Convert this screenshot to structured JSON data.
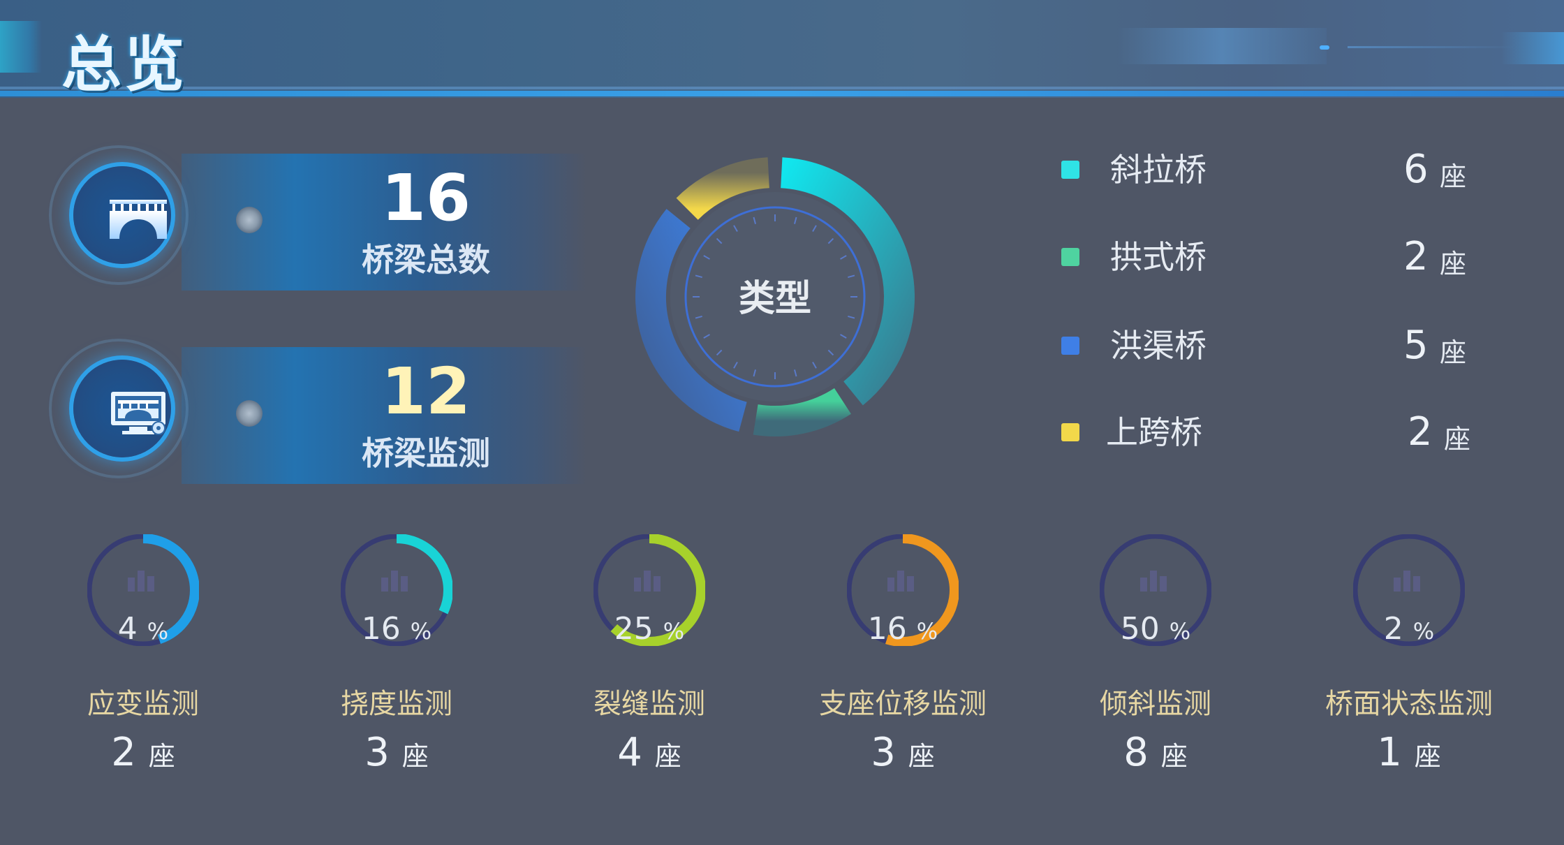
{
  "header": {
    "title": "总览"
  },
  "stats": [
    {
      "value": "16",
      "label": "桥梁总数",
      "icon": "bridge-icon"
    },
    {
      "value": "12",
      "label": "桥梁监测",
      "icon": "monitor-icon"
    }
  ],
  "chart_data": {
    "type": "pie",
    "title": "类型",
    "unit": "座",
    "categories": [
      "斜拉桥",
      "拱式桥",
      "洪渠桥",
      "上跨桥"
    ],
    "values": [
      6,
      2,
      5,
      2
    ],
    "colors": [
      "#2fe3e6",
      "#4fd3a0",
      "#3f7fe6",
      "#f2d84a"
    ]
  },
  "legend": {
    "unit": "座",
    "items": [
      {
        "name": "斜拉桥",
        "count": "6",
        "color": "#2fe3e6"
      },
      {
        "name": "拱式桥",
        "count": "2",
        "color": "#4fd3a0"
      },
      {
        "name": "洪渠桥",
        "count": "5",
        "color": "#3f7fe6"
      },
      {
        "name": "上跨桥",
        "count": "2",
        "color": "#f2d84a"
      }
    ]
  },
  "gauges": {
    "unit": "座",
    "pct_unit": "%",
    "items": [
      {
        "percent": 4,
        "pct_text": "4",
        "name": "应变监测",
        "count": "2",
        "color": "#1f9fe8",
        "arc": 0.45
      },
      {
        "percent": 16,
        "pct_text": "16",
        "name": "挠度监测",
        "count": "3",
        "color": "#19d3d6",
        "arc": 0.32
      },
      {
        "percent": 25,
        "pct_text": "25",
        "name": "裂缝监测",
        "count": "4",
        "color": "#a7d12b",
        "arc": 0.62
      },
      {
        "percent": 16,
        "pct_text": "16",
        "name": "支座位移监测",
        "count": "3",
        "color": "#f0971e",
        "arc": 0.55
      },
      {
        "percent": 50,
        "pct_text": "50",
        "name": "倾斜监测",
        "count": "8",
        "color": "#3b3f86",
        "arc": 0
      },
      {
        "percent": 2,
        "pct_text": "2",
        "name": "桥面状态监测",
        "count": "1",
        "color": "#3b3f86",
        "arc": 0
      }
    ]
  }
}
